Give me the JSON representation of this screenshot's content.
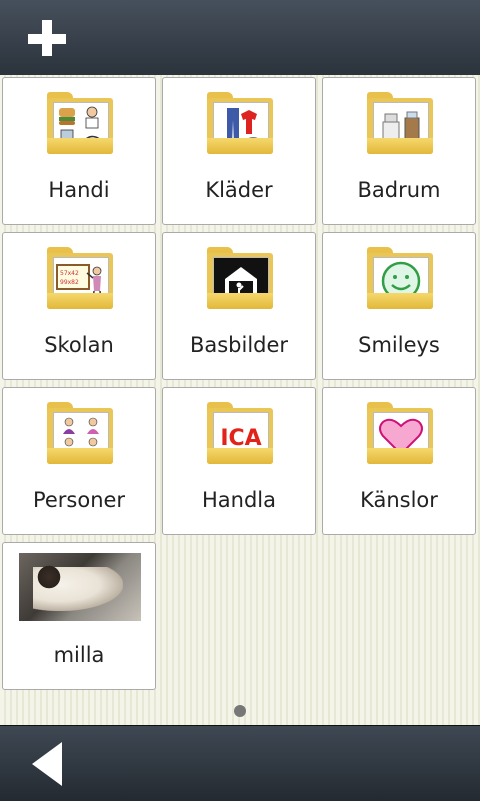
{
  "toolbar": {
    "add_icon": "plus-icon"
  },
  "tiles": [
    {
      "label": "Handi",
      "icon": "handi-folder-icon"
    },
    {
      "label": "Kläder",
      "icon": "clothes-folder-icon"
    },
    {
      "label": "Badrum",
      "icon": "bathroom-folder-icon"
    },
    {
      "label": "Skolan",
      "icon": "school-folder-icon"
    },
    {
      "label": "Basbilder",
      "icon": "basic-pictures-folder-icon"
    },
    {
      "label": "Smileys",
      "icon": "smiley-folder-icon"
    },
    {
      "label": "Personer",
      "icon": "people-folder-icon"
    },
    {
      "label": "Handla",
      "icon": "shopping-folder-icon"
    },
    {
      "label": "Känslor",
      "icon": "feelings-folder-icon"
    },
    {
      "label": "milla",
      "icon": "cat-photo"
    }
  ],
  "folder_art": {
    "school_board": "57x42\n99x82",
    "shop_logo": "ICA"
  },
  "pager": {
    "active_page": 1
  },
  "navigation": {
    "back_icon": "back-arrow-icon"
  },
  "colors": {
    "toolbar": "#3a434e",
    "folder": "#e9c655",
    "ica_red": "#e2231a",
    "smiley_green": "#2f9e44",
    "heart_pink": "#f7a8d0"
  }
}
